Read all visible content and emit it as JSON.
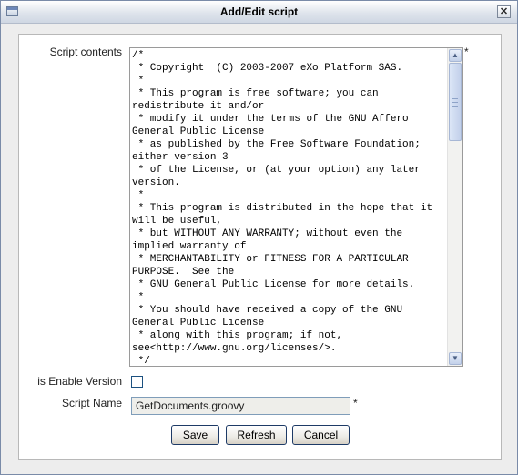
{
  "window": {
    "title": "Add/Edit script",
    "close_glyph": "✕"
  },
  "form": {
    "script_contents_label": "Script contents",
    "script_contents": "/*\n * Copyright  (C) 2003-2007 eXo Platform SAS.\n *\n * This program is free software; you can redistribute it and/or\n * modify it under the terms of the GNU Affero General Public License\n * as published by the Free Software Foundation; either version 3\n * of the License, or (at your option) any later version.\n *\n * This program is distributed in the hope that it will be useful,\n * but WITHOUT ANY WARRANTY; without even the implied warranty of\n * MERCHANTABILITY or FITNESS FOR A PARTICULAR PURPOSE.  See the\n * GNU General Public License for more details.\n *\n * You should have received a copy of the GNU General Public License\n * along with this program; if not, see<http://www.gnu.org/licenses/>.\n */",
    "required_marker": "*",
    "enable_version_label": "is Enable Version",
    "enable_version_checked": false,
    "script_name_label": "Script Name",
    "script_name_value": "GetDocuments.groovy"
  },
  "buttons": {
    "save": "Save",
    "refresh": "Refresh",
    "cancel": "Cancel"
  },
  "scrollbar": {
    "up_glyph": "▲",
    "down_glyph": "▼"
  },
  "icons": {
    "window": "window-icon",
    "close": "close-icon",
    "scroll_up": "arrow-up-icon",
    "scroll_down": "arrow-down-icon"
  }
}
